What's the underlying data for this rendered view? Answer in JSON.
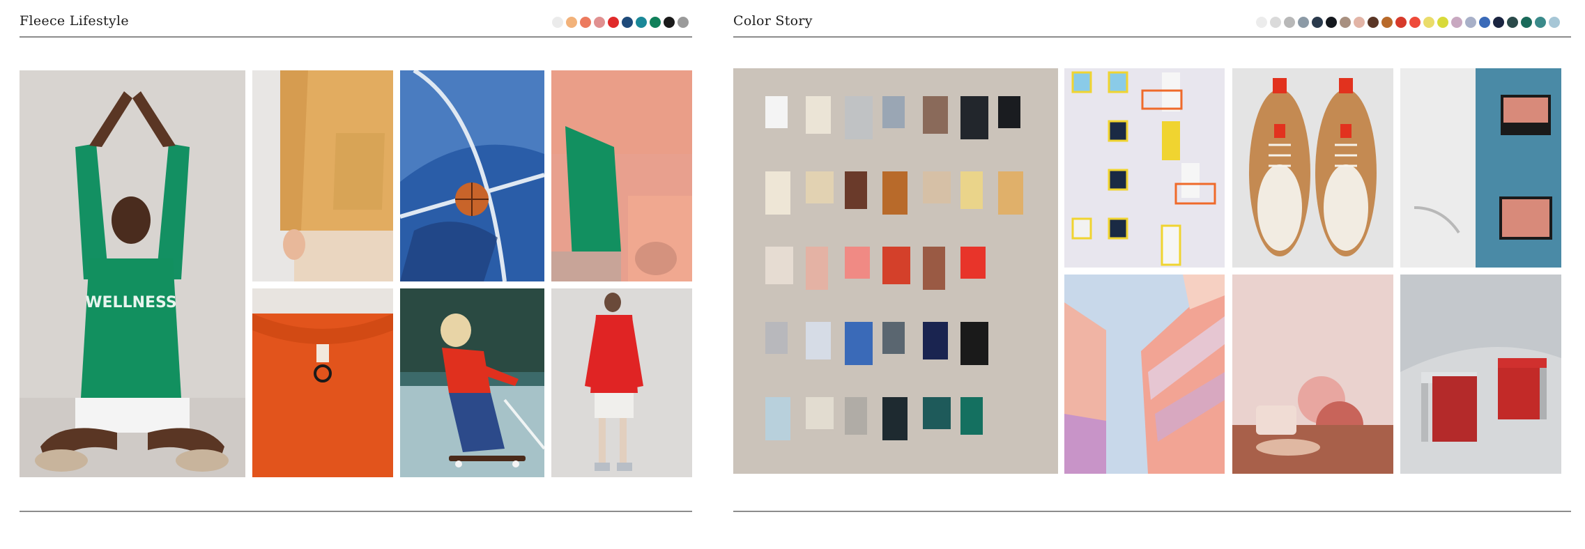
{
  "fleece_lifestyle": {
    "title": "Fleece Lifestyle",
    "swatches": [
      "#ebebeb",
      "#f2b27a",
      "#ec7a5e",
      "#e09090",
      "#e02a2a",
      "#1e4a7a",
      "#1a8898",
      "#10805a",
      "#1a1a1a",
      "#9a9a9a"
    ],
    "sweatshirt_print": "WELLNESS"
  },
  "color_story": {
    "title": "Color Story",
    "swatches": [
      "#ececec",
      "#dadada",
      "#b8b8b8",
      "#8c9aa6",
      "#2a3a4c",
      "#14181e",
      "#a89080",
      "#e2b4a6",
      "#5a3626",
      "#b86a2a",
      "#d63a2a",
      "#ee4a3a",
      "#eadc6a",
      "#d8da3a",
      "#c8a8c0",
      "#a8b0c8",
      "#3a6ab8",
      "#1a2440",
      "#2a4a4a",
      "#1a6a5a",
      "#3a8a8a",
      "#a6c6d6"
    ]
  },
  "icons": [
    "tile-photo"
  ]
}
